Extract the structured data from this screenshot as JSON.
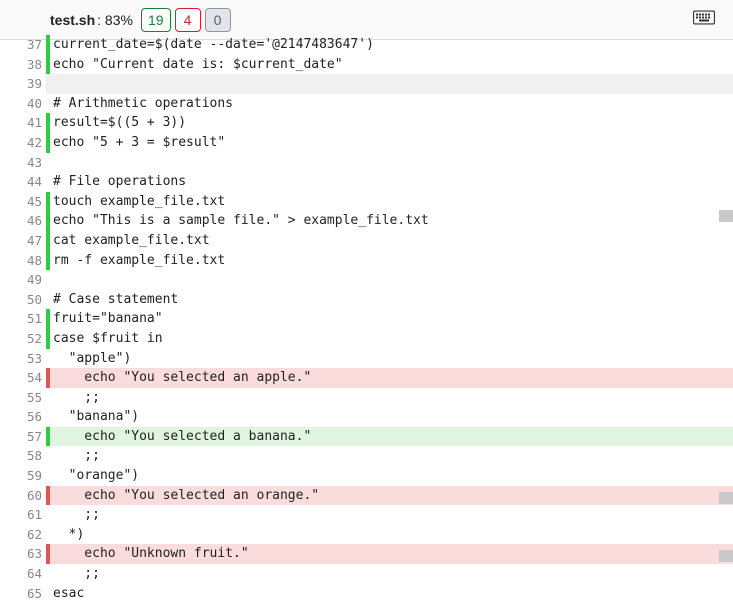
{
  "toolbar": {
    "filename": "test.sh",
    "percent": ": 83%",
    "badges": {
      "green": "19",
      "red": "4",
      "gray": "0"
    }
  },
  "lines": [
    {
      "n": 37,
      "marker": "green",
      "hl": "",
      "text": "current_date=$(date --date='@2147483647')"
    },
    {
      "n": 38,
      "marker": "green",
      "hl": "",
      "text": "echo \"Current date is: $current_date\""
    },
    {
      "n": 39,
      "marker": "",
      "hl": "gray",
      "text": ""
    },
    {
      "n": 40,
      "marker": "",
      "hl": "",
      "text": "# Arithmetic operations"
    },
    {
      "n": 41,
      "marker": "green",
      "hl": "",
      "text": "result=$((5 + 3))"
    },
    {
      "n": 42,
      "marker": "green",
      "hl": "",
      "text": "echo \"5 + 3 = $result\""
    },
    {
      "n": 43,
      "marker": "",
      "hl": "",
      "text": ""
    },
    {
      "n": 44,
      "marker": "",
      "hl": "",
      "text": "# File operations"
    },
    {
      "n": 45,
      "marker": "green",
      "hl": "",
      "text": "touch example_file.txt"
    },
    {
      "n": 46,
      "marker": "green",
      "hl": "",
      "text": "echo \"This is a sample file.\" > example_file.txt"
    },
    {
      "n": 47,
      "marker": "green",
      "hl": "",
      "text": "cat example_file.txt"
    },
    {
      "n": 48,
      "marker": "green",
      "hl": "",
      "text": "rm -f example_file.txt"
    },
    {
      "n": 49,
      "marker": "",
      "hl": "",
      "text": ""
    },
    {
      "n": 50,
      "marker": "",
      "hl": "",
      "text": "# Case statement"
    },
    {
      "n": 51,
      "marker": "green",
      "hl": "",
      "text": "fruit=\"banana\""
    },
    {
      "n": 52,
      "marker": "green",
      "hl": "",
      "text": "case $fruit in"
    },
    {
      "n": 53,
      "marker": "",
      "hl": "",
      "text": "  \"apple\")"
    },
    {
      "n": 54,
      "marker": "red",
      "hl": "red",
      "text": "    echo \"You selected an apple.\""
    },
    {
      "n": 55,
      "marker": "",
      "hl": "",
      "text": "    ;;"
    },
    {
      "n": 56,
      "marker": "",
      "hl": "",
      "text": "  \"banana\")"
    },
    {
      "n": 57,
      "marker": "green",
      "hl": "green",
      "text": "    echo \"You selected a banana.\""
    },
    {
      "n": 58,
      "marker": "",
      "hl": "",
      "text": "    ;;"
    },
    {
      "n": 59,
      "marker": "",
      "hl": "",
      "text": "  \"orange\")"
    },
    {
      "n": 60,
      "marker": "red",
      "hl": "red",
      "text": "    echo \"You selected an orange.\""
    },
    {
      "n": 61,
      "marker": "",
      "hl": "",
      "text": "    ;;"
    },
    {
      "n": 62,
      "marker": "",
      "hl": "",
      "text": "  *)"
    },
    {
      "n": 63,
      "marker": "red",
      "hl": "red",
      "text": "    echo \"Unknown fruit.\""
    },
    {
      "n": 64,
      "marker": "",
      "hl": "",
      "text": "    ;;"
    },
    {
      "n": 65,
      "marker": "",
      "hl": "",
      "text": "esac"
    }
  ],
  "scroll_marks": [
    210,
    492,
    550
  ]
}
